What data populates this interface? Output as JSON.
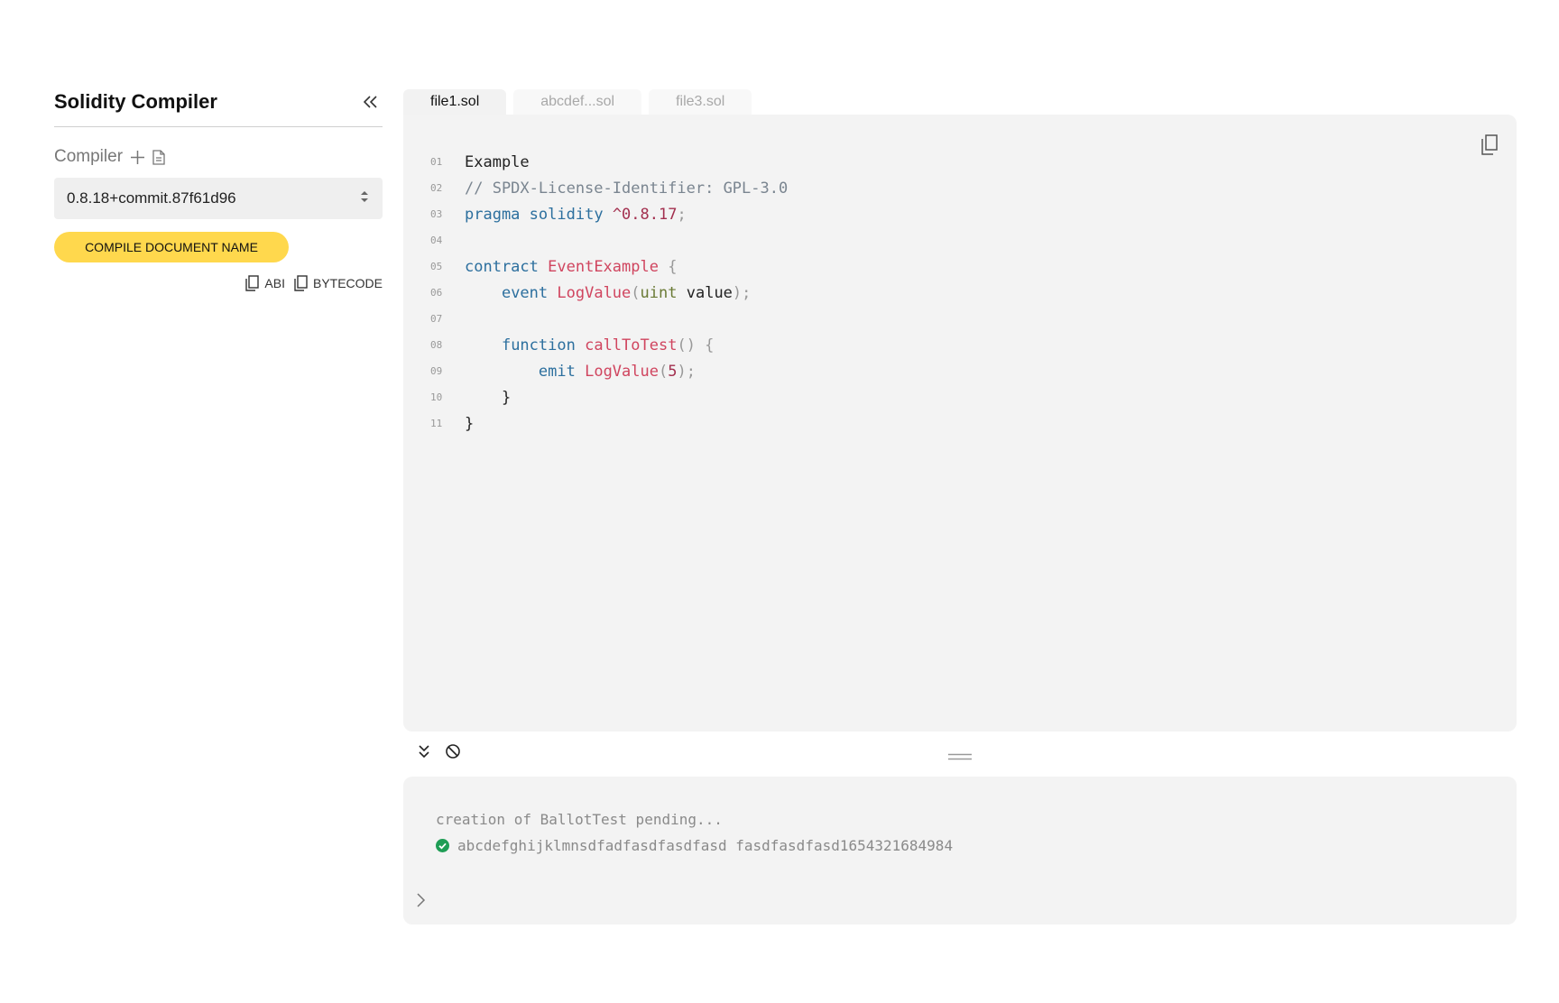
{
  "sidebar": {
    "title": "Solidity Compiler",
    "compiler_label": "Compiler",
    "compiler_version": "0.8.18+commit.87f61d96",
    "compile_button": "COMPILE DOCUMENT NAME",
    "abi_label": "ABI",
    "bytecode_label": "BYTECODE"
  },
  "tabs": [
    {
      "label": "file1.sol",
      "active": true
    },
    {
      "label": "abcdef...sol",
      "active": false
    },
    {
      "label": "file3.sol",
      "active": false
    }
  ],
  "editor": {
    "line_numbers": [
      "01",
      "02",
      "03",
      "04",
      "05",
      "06",
      "07",
      "08",
      "09",
      "10",
      "11"
    ],
    "line1": "Example",
    "line2": "// SPDX-License-Identifier: GPL-3.0",
    "line3": {
      "kw1": "pragma",
      "kw2": "solidity",
      "ver": "^0.8.17",
      "semi": ";"
    },
    "line5": {
      "kw": "contract",
      "name": "EventExample",
      "brace": "{"
    },
    "line6": {
      "kw": "event",
      "name": "LogValue",
      "lp": "(",
      "type": "uint",
      "param": "value",
      "rp": ");"
    },
    "line8": {
      "kw": "function",
      "name": "callToTest",
      "rest": "() {"
    },
    "line9": {
      "kw": "emit",
      "name": "LogValue",
      "lp": "(",
      "num": "5",
      "rp": ");"
    },
    "line10": "}",
    "line11": "}"
  },
  "console": {
    "log1": "creation of BallotTest pending...",
    "log2": "abcdefghijklmnsdfadfasdfasdfasd fasdfasdfasd1654321684984"
  },
  "icons": {
    "collapse": "chevrons-left-icon",
    "add": "plus-icon",
    "file": "file-icon",
    "select_arrows": "sort-arrows-icon",
    "copy": "copy-icon",
    "expand": "chevrons-down-icon",
    "clear": "ban-icon",
    "drag": "drag-handle-icon",
    "prompt": "chevron-right-icon",
    "success": "check-circle-icon"
  },
  "colors": {
    "accent": "#ffd84d",
    "panel": "#f3f3f3",
    "success": "#1f9d55",
    "keyword": "#2c6f9e",
    "identifier": "#d0455f"
  }
}
